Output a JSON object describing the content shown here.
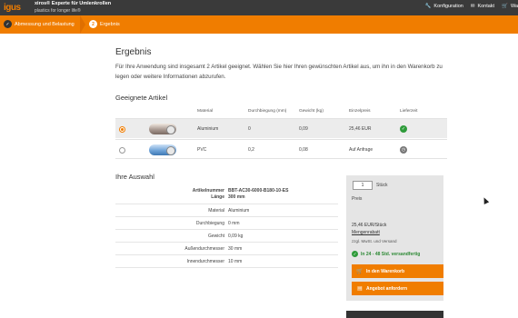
{
  "header": {
    "logo": "igus",
    "app_title": "xiros® Experte für Umlenkrollen",
    "app_subtitle": "plastics for longer life®",
    "nav": [
      {
        "label": "Konfiguration",
        "icon": "tools-icon"
      },
      {
        "label": "Kontakt",
        "icon": "mail-icon"
      },
      {
        "label": "Wa",
        "icon": "cart-icon"
      }
    ]
  },
  "steps": [
    {
      "number": "✓",
      "label": "Abmessung und Belastung",
      "state": "done"
    },
    {
      "number": "2",
      "label": "Ergebnis",
      "state": "active"
    }
  ],
  "main": {
    "title": "Ergebnis",
    "intro": "Für Ihre Anwendung sind insgesamt 2 Artikel geeignet. Wählen Sie hier Ihren gewünschten Artikel aus, um ihn in den Warenkorb zu legen oder weitere Informationen abzurufen.",
    "section_suitable": "Geeignete Artikel",
    "columns": [
      "Material",
      "Durchbiegung (mm)",
      "Gewicht (kg)",
      "Einzelpreis",
      "Lieferzeit"
    ],
    "rows": [
      {
        "material": "Aluminium",
        "deflection": "0",
        "weight": "0,09",
        "price": "25,46 EUR",
        "delivery_icon": "check-icon",
        "selected": true
      },
      {
        "material": "PVC",
        "deflection": "0,2",
        "weight": "0,08",
        "price": "Auf Anfrage",
        "delivery_icon": "clock-icon",
        "selected": false
      }
    ],
    "section_choice": "Ihre Auswahl",
    "details": [
      {
        "key": "Artikelnummer\nLänge",
        "value": "BBT-AC30-6000-B180-10-ES\n300 mm"
      },
      {
        "key": "Material",
        "value": "Aluminium"
      },
      {
        "key": "Durchbiegung",
        "value": "0 mm"
      },
      {
        "key": "Gewicht",
        "value": "0,09 kg"
      },
      {
        "key": "Außendurchmesser",
        "value": "30 mm"
      },
      {
        "key": "Innendurchmesser",
        "value": "10 mm"
      }
    ]
  },
  "order": {
    "quantity": "1",
    "quantity_unit": "Stück",
    "price_label": "Preis",
    "price": "25,46 EUR/Stück",
    "volume_discount": "Mengenrabatt",
    "shipping_note": "zzgl. MwSt. und Versand",
    "availability": "In 24 - 48 Std. versandfertig",
    "add_to_cart": "In den Warenkorb",
    "request_quote": "Angebot anfordern"
  },
  "colors": {
    "accent": "#f07d00",
    "header_bg": "#3a3a3a",
    "ok_green": "#2e9b3a"
  }
}
